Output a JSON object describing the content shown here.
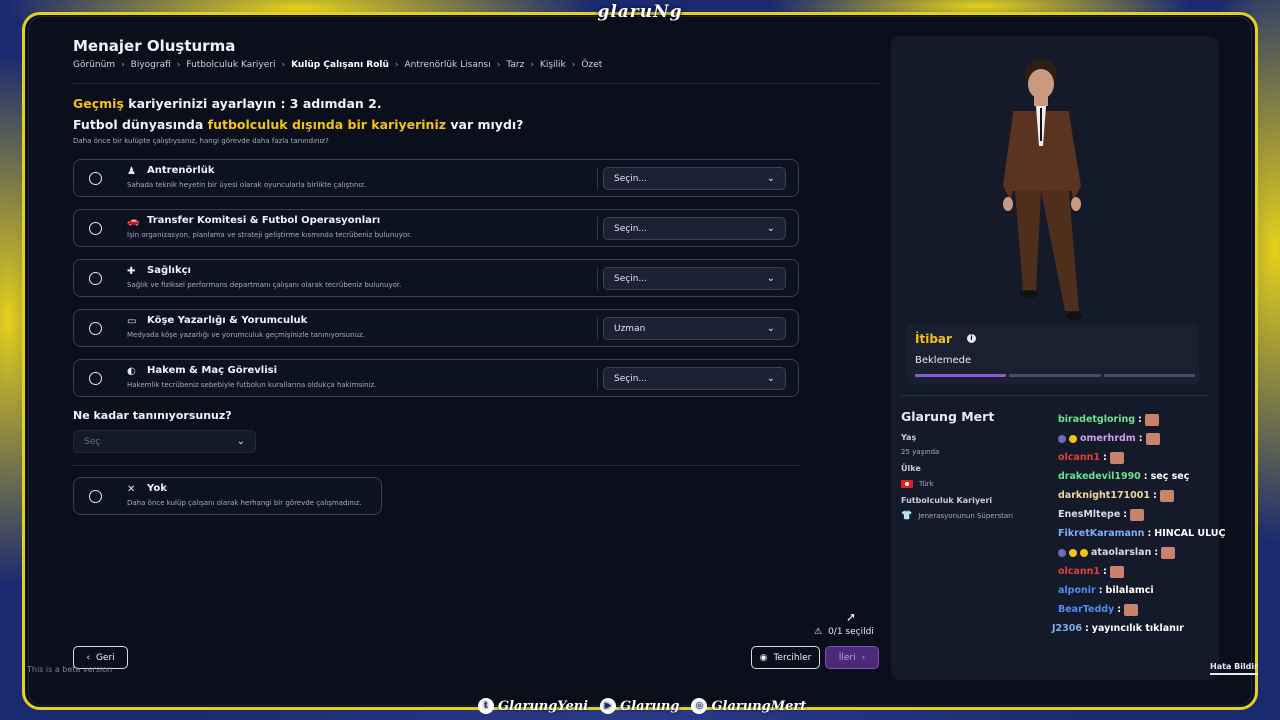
{
  "brand": "glaruNg",
  "page": {
    "title": "Menajer Oluşturma",
    "breadcrumbs": [
      "Görünüm",
      "Biyografi",
      "Futbolculuk Kariyeri",
      "Kulüp Çalışanı Rolü",
      "Antrenörlük Lisansı",
      "Tarz",
      "Kişilik",
      "Özet"
    ],
    "active_crumb": "Kulüp Çalışanı Rolü"
  },
  "question": {
    "line1_highlight": "Geçmiş",
    "line1_rest": " kariyerinizi ayarlayın : 3 adımdan 2.",
    "line2_pre": "Futbol dünyasında ",
    "line2_highlight": "futbolculuk dışında bir kariyeriniz",
    "line2_post": " var mıydı?",
    "hint": "Daha önce bir kulüpte çalıştıysanız, hangi görevde daha fazla tanındınız?"
  },
  "options": [
    {
      "icon": "coach-icon",
      "glyph": "♟",
      "title": "Antrenörlük",
      "desc": "Sahada teknik heyetin bir üyesi olarak oyuncularla birlikte çalıştınız.",
      "select": "Seçin..."
    },
    {
      "icon": "car-icon",
      "glyph": "🚗",
      "title": "Transfer Komitesi & Futbol Operasyonları",
      "desc": "İşin organizasyon, planlama ve strateji geliştirme kısmında tecrübeniz bulunuyor.",
      "select": "Seçin..."
    },
    {
      "icon": "medkit-icon",
      "glyph": "✚",
      "title": "Sağlıkçı",
      "desc": "Sağlık ve fiziksel performans departmanı çalışanı olarak tecrübeniz bulunuyor.",
      "select": "Seçin..."
    },
    {
      "icon": "monitor-icon",
      "glyph": "▭",
      "title": "Köşe Yazarlığı & Yorumculuk",
      "desc": "Medyada köşe yazarlığı ve yorumculuk geçmişinizle tanınıyorsunuz.",
      "select": "Uzman"
    },
    {
      "icon": "whistle-icon",
      "glyph": "◐",
      "title": "Hakem & Maç Görevlisi",
      "desc": "Hakemlik tecrübeniz sebebiyle futbolun kurallarına oldukça hakimsiniz.",
      "select": "Seçin..."
    }
  ],
  "fame": {
    "question": "Ne kadar tanınıyorsunuz?",
    "placeholder": "Seç"
  },
  "none_option": {
    "glyph": "✕",
    "title": "Yok",
    "desc": "Daha önce kulüp çalışanı olarak herhangi bir görevde çalışmadınız."
  },
  "footer": {
    "back": "Geri",
    "beta": "This is a beta version",
    "counter": "0/1 seçildi",
    "preferences": "Tercihler",
    "next": "İleri"
  },
  "profile": {
    "rep_title": "İtibar",
    "rep_status": "Beklemede",
    "rep_progress_fraction": 0.33,
    "name": "Glarung Mert",
    "age_label": "Yaş",
    "age_value": "25 yaşında",
    "country_label": "Ülke",
    "country_value": "Türk",
    "career_label": "Futbolculuk Kariyeri",
    "career_value": "Jenerasyonunun Süperstarı",
    "report": "Hata Bildir"
  },
  "chat": [
    {
      "user": "biradetgloring",
      "color": "#6de38a",
      "msg": "",
      "emote": true,
      "badges": ""
    },
    {
      "user": "omerhrdm",
      "color": "#d59df4",
      "msg": "",
      "emote": true,
      "badges": "p,y"
    },
    {
      "user": "olcann1",
      "color": "#e0413a",
      "msg": "",
      "emote": true,
      "badges": ""
    },
    {
      "user": "drakedevil1990",
      "color": "#6de38a",
      "msg": "seç seç",
      "emote": false,
      "badges": ""
    },
    {
      "user": "darknight171001",
      "color": "#f0d7a0",
      "msg": "",
      "emote": true,
      "badges": ""
    },
    {
      "user": "EnesMltepe",
      "color": "#d8dbe4",
      "msg": "",
      "emote": true,
      "badges": ""
    },
    {
      "user": "FikretKaramann",
      "color": "#7fb0f0",
      "msg": "HINCAL ULUÇ",
      "emote": false,
      "badges": ""
    },
    {
      "user": "ataolarslan",
      "color": "#d8dbe4",
      "msg": "",
      "emote": true,
      "badges": "p,y,y"
    },
    {
      "user": "olcann1",
      "color": "#e0413a",
      "msg": "",
      "emote": true,
      "badges": ""
    },
    {
      "user": "alponir",
      "color": "#4f8ef0",
      "msg": "bilalamci",
      "emote": false,
      "badges": ""
    },
    {
      "user": "BearTeddy",
      "color": "#4f8ef0",
      "msg": "",
      "emote": true,
      "badges": ""
    },
    {
      "user": "J2306",
      "color": "#7fb0f0",
      "msg": "yayıncılık tıklanır",
      "emote": false,
      "badges": ""
    }
  ],
  "socials": [
    {
      "icon": "twitter-icon",
      "glyph": "t",
      "label": "GlarungYeni"
    },
    {
      "icon": "youtube-icon",
      "glyph": "▶",
      "label": "Glarung"
    },
    {
      "icon": "instagram-icon",
      "glyph": "◎",
      "label": "GlarungMert"
    }
  ],
  "colors": {
    "accent": "#f2c21a",
    "frame": "#e3d21c",
    "purple": "#8c5bd6",
    "bg": "#0b0f1c"
  }
}
